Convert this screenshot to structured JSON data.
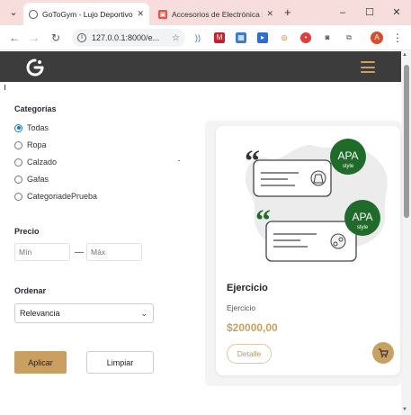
{
  "browser": {
    "tabs": [
      {
        "title": "GoToGym - Lujo Deportivo y",
        "active": true,
        "favicon": "globe-icon"
      },
      {
        "title": "Accesorios de Electrónica | A",
        "active": false,
        "favicon": "store-icon"
      }
    ],
    "url": "127.0.0.1:8000/e...",
    "avatar_letter": "A",
    "new_tab": "+",
    "close": "✕"
  },
  "colors": {
    "accent": "#c9a062",
    "header_bg": "#3c3c3c",
    "apa_green": "#1e6b2a"
  },
  "filters": {
    "categories_title": "Categorías",
    "categories": [
      {
        "label": "Todas",
        "checked": true
      },
      {
        "label": "Ropa",
        "checked": false
      },
      {
        "label": "Calzado",
        "checked": false
      },
      {
        "label": "Gafas",
        "checked": false
      },
      {
        "label": "CategoriadePrueba",
        "checked": false
      }
    ],
    "price_title": "Precio",
    "min_placeholder": "Mín",
    "max_placeholder": "Máx",
    "price_separator": "—",
    "order_title": "Ordenar",
    "order_selected": "Relevancia",
    "apply_label": "Aplicar",
    "clear_label": "Limpiar"
  },
  "product": {
    "name": "Ejercicio",
    "category": "Ejercicio",
    "price": "$20000,00",
    "detail_label": "Detalle",
    "badge_top": {
      "main": "APA",
      "sub": "style"
    },
    "badge_bottom": {
      "main": "APA",
      "sub": "style"
    }
  }
}
